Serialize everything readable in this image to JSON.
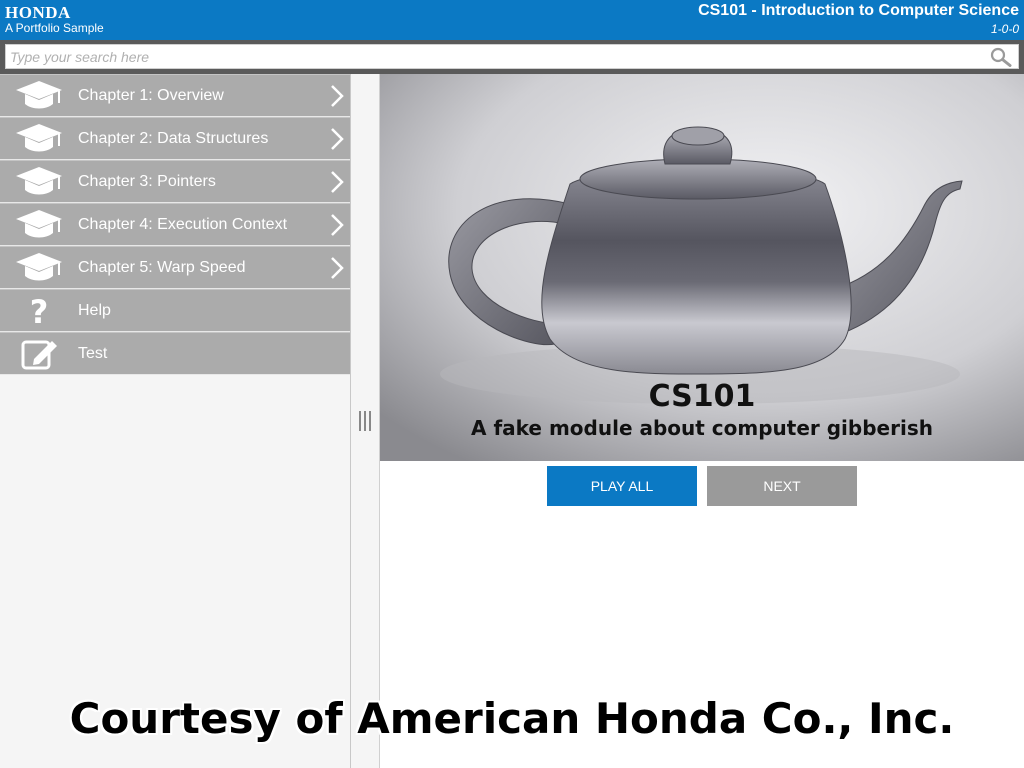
{
  "header": {
    "brand": "HONDA",
    "brand_subtitle": "A Portfolio Sample",
    "course_title": "CS101 - Introduction to Computer Science",
    "version": "1-0-0"
  },
  "search": {
    "placeholder": "Type your search here",
    "value": "",
    "icon": "search-icon"
  },
  "sidebar": {
    "items": [
      {
        "label": "Chapter 1: Overview",
        "icon": "graduation-cap-icon",
        "has_chevron": true
      },
      {
        "label": "Chapter 2: Data Structures",
        "icon": "graduation-cap-icon",
        "has_chevron": true
      },
      {
        "label": "Chapter 3: Pointers",
        "icon": "graduation-cap-icon",
        "has_chevron": true
      },
      {
        "label": "Chapter 4: Execution Context",
        "icon": "graduation-cap-icon",
        "has_chevron": true
      },
      {
        "label": "Chapter 5: Warp Speed",
        "icon": "graduation-cap-icon",
        "has_chevron": true
      },
      {
        "label": "Help",
        "icon": "question-mark-icon",
        "has_chevron": false
      },
      {
        "label": "Test",
        "icon": "pencil-edit-icon",
        "has_chevron": false
      }
    ]
  },
  "main": {
    "hero_title": "CS101",
    "hero_subtitle": "A fake module about computer gibberish",
    "play_all_label": "PLAY ALL",
    "next_label": "NEXT"
  },
  "watermark": {
    "text": "Courtesy of American Honda Co., Inc."
  },
  "colors": {
    "header_blue": "#0b79c4",
    "menu_gray": "#ababab",
    "next_gray": "#9a9a9a"
  }
}
